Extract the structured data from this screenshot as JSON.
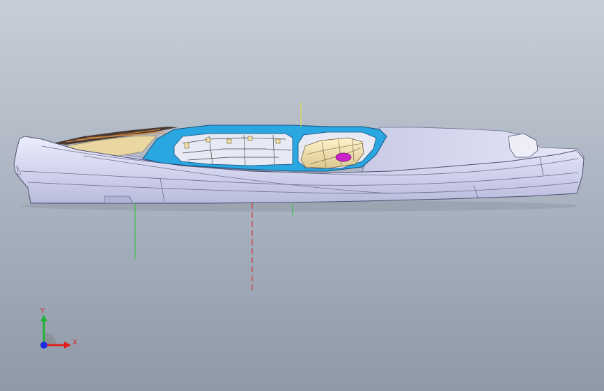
{
  "viewport": {
    "background_top": "#c8ced7",
    "background_bottom": "#8f99a7"
  },
  "model": {
    "body_color": "#d7d8f0",
    "canopy_frame_color": "#2aa6e0",
    "interior_color": "#f0dca4",
    "highlight_color": "#cc22cc"
  },
  "triad": {
    "x_label": "X",
    "y_label": "Y",
    "x_color": "#e01e1e",
    "y_color": "#25b23a",
    "z_color": "#1c2de0"
  },
  "reference_lines": {
    "green_color": "#28c23c",
    "red_color": "#e01e1e",
    "yellow_color": "#e6e22a"
  }
}
